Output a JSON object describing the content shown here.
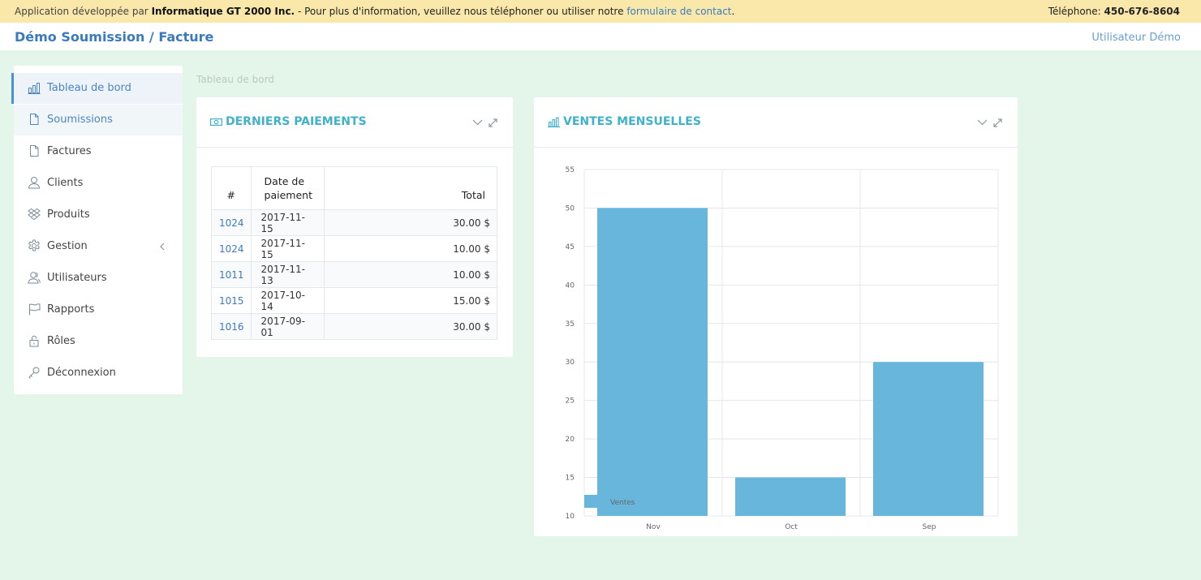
{
  "topbar": {
    "prefix": "Application développée par ",
    "company": "Informatique GT 2000 Inc.",
    "middle": " -  Pour plus d'information, veuillez nous téléphoner ou utiliser notre ",
    "link": "formulaire de contact",
    "suffix": ".",
    "phone_label": "Téléphone: ",
    "phone": "450-676-8604"
  },
  "header": {
    "title": "Démo Soumission / Facture",
    "user": "Utilisateur Démo"
  },
  "sidebar": {
    "items": [
      {
        "label": "Tableau de bord",
        "icon": "bar-chart-icon"
      },
      {
        "label": "Soumissions",
        "icon": "document-icon"
      },
      {
        "label": "Factures",
        "icon": "document-icon"
      },
      {
        "label": "Clients",
        "icon": "user-icon"
      },
      {
        "label": "Produits",
        "icon": "dropbox-icon"
      },
      {
        "label": "Gestion",
        "icon": "gear-icon"
      },
      {
        "label": "Utilisateurs",
        "icon": "users-icon"
      },
      {
        "label": "Rapports",
        "icon": "flag-icon"
      },
      {
        "label": "Rôles",
        "icon": "lock-icon"
      },
      {
        "label": "Déconnexion",
        "icon": "key-icon"
      }
    ]
  },
  "breadcrumb": "Tableau de bord",
  "payments": {
    "title": "DERNIERS PAIEMENTS",
    "columns": [
      "#",
      "Date de paiement",
      "Total"
    ],
    "rows": [
      {
        "id": "1024",
        "date": "2017-11-15",
        "total": "30.00 $"
      },
      {
        "id": "1024",
        "date": "2017-11-15",
        "total": "10.00 $"
      },
      {
        "id": "1011",
        "date": "2017-11-13",
        "total": "10.00 $"
      },
      {
        "id": "1015",
        "date": "2017-10-14",
        "total": "15.00 $"
      },
      {
        "id": "1016",
        "date": "2017-09-01",
        "total": "30.00 $"
      }
    ]
  },
  "sales": {
    "title": "VENTES MENSUELLES"
  },
  "colors": {
    "accent": "#3fb1c9",
    "link": "#3a7bbf",
    "bar": "#68b6dc",
    "banner": "#f9e8a9",
    "background": "#e4f6ea"
  },
  "chart_data": {
    "type": "bar",
    "categories": [
      "Nov",
      "Oct",
      "Sep"
    ],
    "series": [
      {
        "name": "Ventes",
        "values": [
          50,
          15,
          30
        ]
      }
    ],
    "ylim": [
      10,
      55
    ],
    "yticks": [
      10,
      15,
      20,
      25,
      30,
      35,
      40,
      45,
      50,
      55
    ],
    "grid": true,
    "legend": "bottom-left"
  }
}
